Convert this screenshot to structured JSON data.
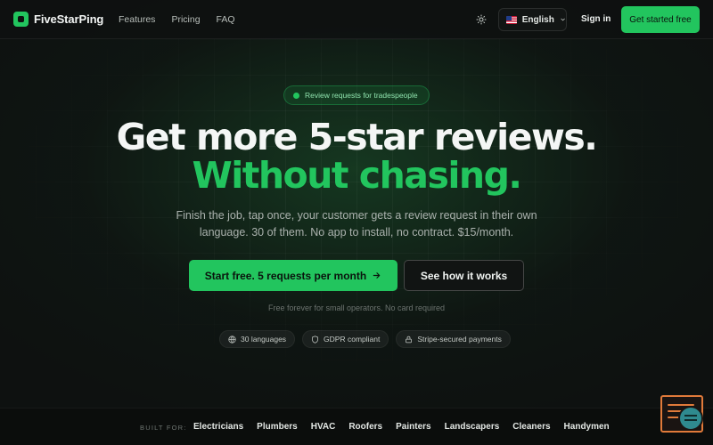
{
  "nav": {
    "brand": "FiveStarPing",
    "links": [
      "Features",
      "Pricing",
      "FAQ"
    ],
    "theme_icon": "sun-icon",
    "language": "English",
    "sign_in": "Sign in",
    "cta": "Get started free"
  },
  "hero": {
    "badge": "Review requests for tradespeople",
    "headline_1": "Get more 5-star reviews.",
    "headline_2": "Without chasing.",
    "subtitle": "Finish the job, tap once, your customer gets a review request in their own language. 30 of them. No app to install, no contract. $15/month.",
    "primary_cta": "Start free. 5 requests per month",
    "secondary_cta": "See how it works",
    "fineprint": "Free forever for small operators. No card required",
    "pills": [
      {
        "label": "30 languages",
        "icon": "globe-icon"
      },
      {
        "label": "GDPR compliant",
        "icon": "shield-icon"
      },
      {
        "label": "Stripe-secured payments",
        "icon": "lock-icon"
      }
    ]
  },
  "built_for": {
    "label": "BUILT FOR:",
    "trades": [
      "Electricians",
      "Plumbers",
      "HVAC",
      "Roofers",
      "Painters",
      "Landscapers",
      "Cleaners",
      "Handymen"
    ]
  },
  "colors": {
    "accent": "#22c55e",
    "background": "#0e1110"
  }
}
